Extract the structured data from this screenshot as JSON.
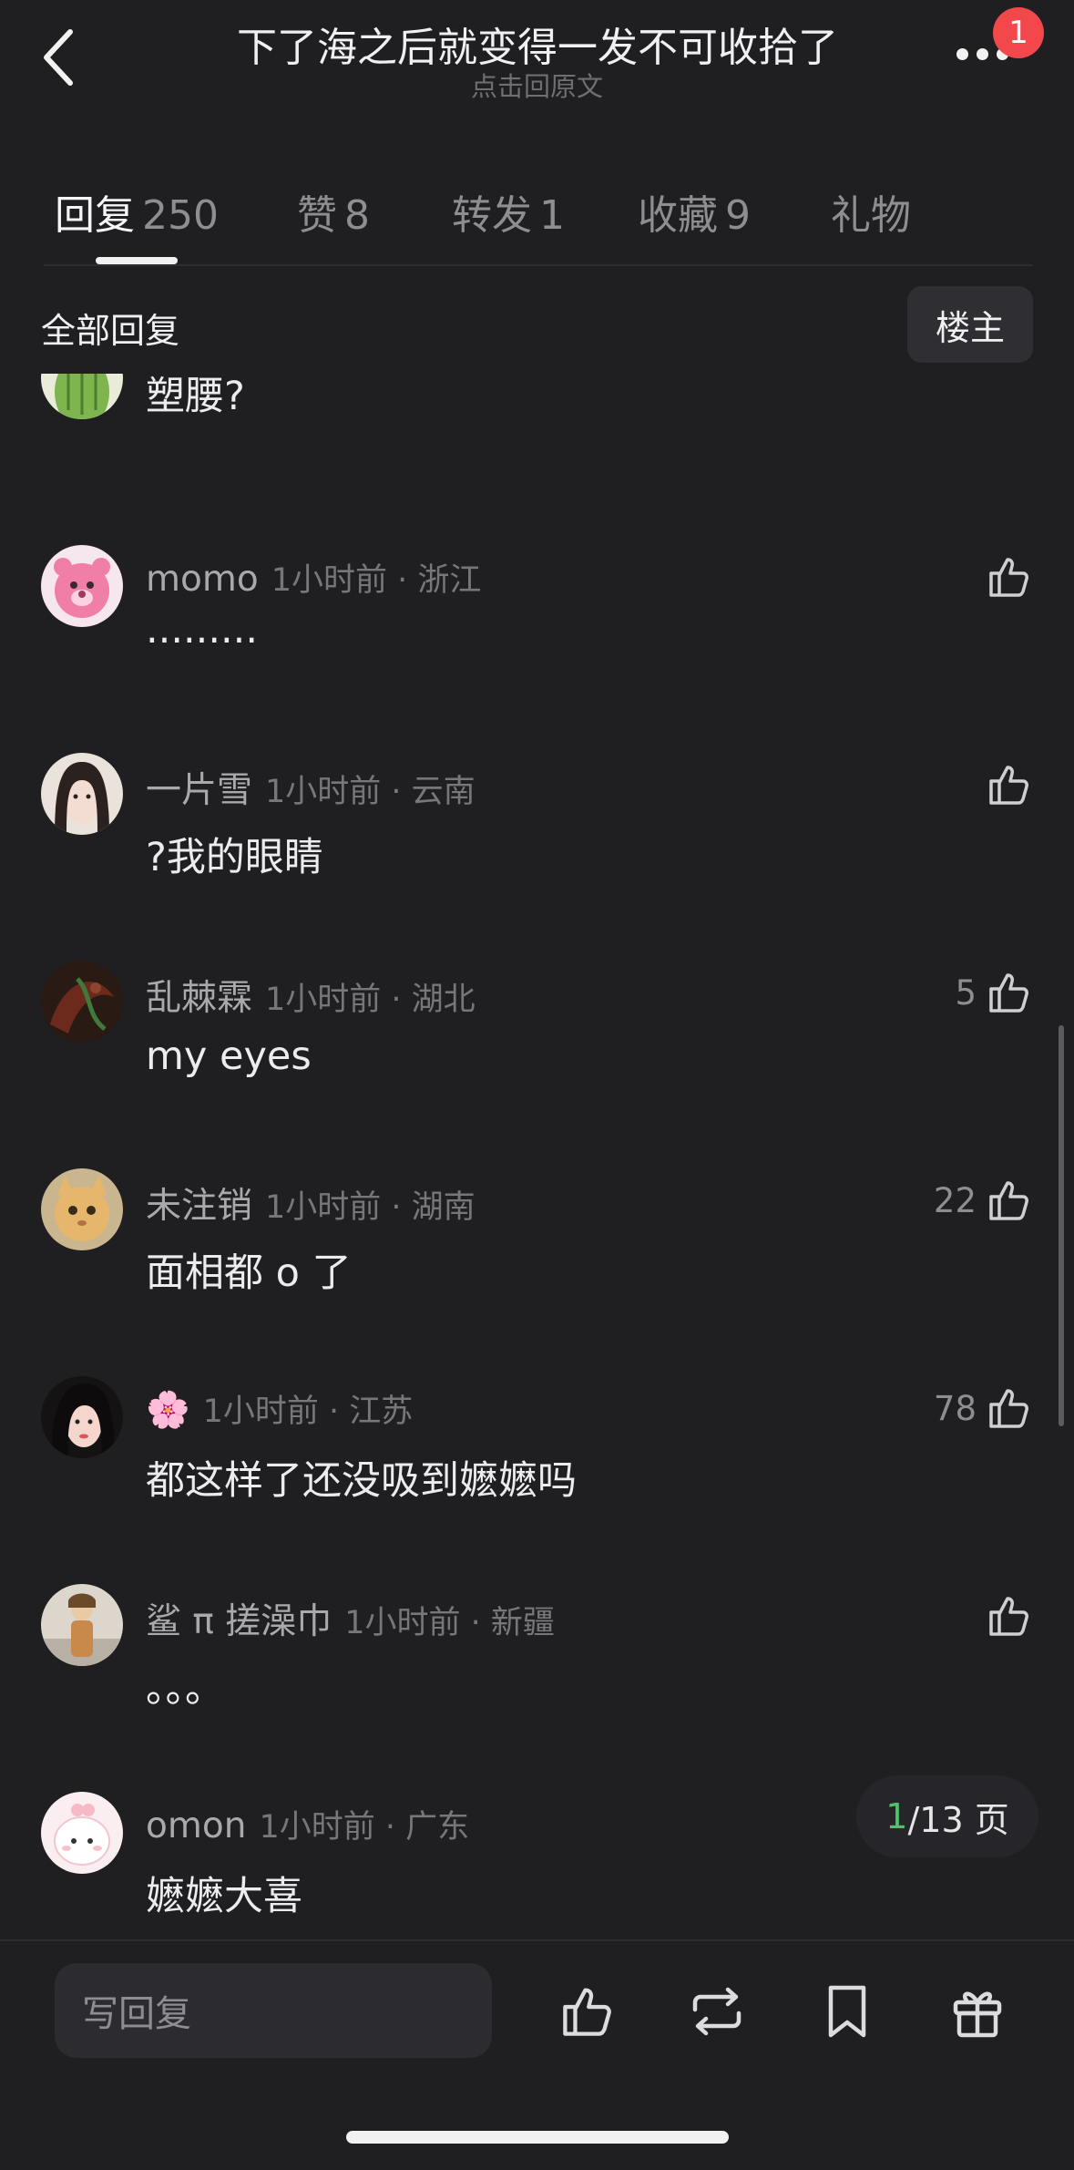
{
  "header": {
    "title": "下了海之后就变得一发不可收拾了",
    "subtitle": "点击回原文",
    "notification_badge": "1"
  },
  "tabs": [
    {
      "label": "回复",
      "count": "250",
      "active": true
    },
    {
      "label": "赞",
      "count": "8"
    },
    {
      "label": "转发",
      "count": "1"
    },
    {
      "label": "收藏",
      "count": "9"
    },
    {
      "label": "礼物",
      "count": ""
    }
  ],
  "filter": {
    "label": "全部回复",
    "op_button": "楼主"
  },
  "comments": [
    {
      "user": "",
      "time": "",
      "text": "塑腰?",
      "likes": ""
    },
    {
      "user": "momo",
      "time": "1小时前 · 浙江",
      "text": "·········",
      "likes": ""
    },
    {
      "user": "一片雪",
      "time": "1小时前 · 云南",
      "text": "?我的眼睛",
      "likes": ""
    },
    {
      "user": "乱棘霖",
      "time": "1小时前 · 湖北",
      "text": "my eyes",
      "likes": "5"
    },
    {
      "user": "未注销",
      "time": "1小时前 · 湖南",
      "text": "面相都 o 了",
      "likes": "22"
    },
    {
      "user": "🌸",
      "time": "1小时前 · 江苏",
      "text": "都这样了还没吸到嬷嬷吗",
      "likes": "78"
    },
    {
      "user": "鲨 π 搓澡巾",
      "time": "1小时前 · 新疆",
      "text": "。。。",
      "likes": ""
    },
    {
      "user": "omon",
      "time": "1小时前 · 广东",
      "text": "嬷嬷大喜",
      "likes": ""
    }
  ],
  "pager": {
    "current": "1",
    "total": "/13 页"
  },
  "bottom": {
    "reply_placeholder": "写回复"
  },
  "colors": {
    "background": "#1f1f21",
    "accent_green": "#4cc46a",
    "badge_red": "#f2474b"
  }
}
